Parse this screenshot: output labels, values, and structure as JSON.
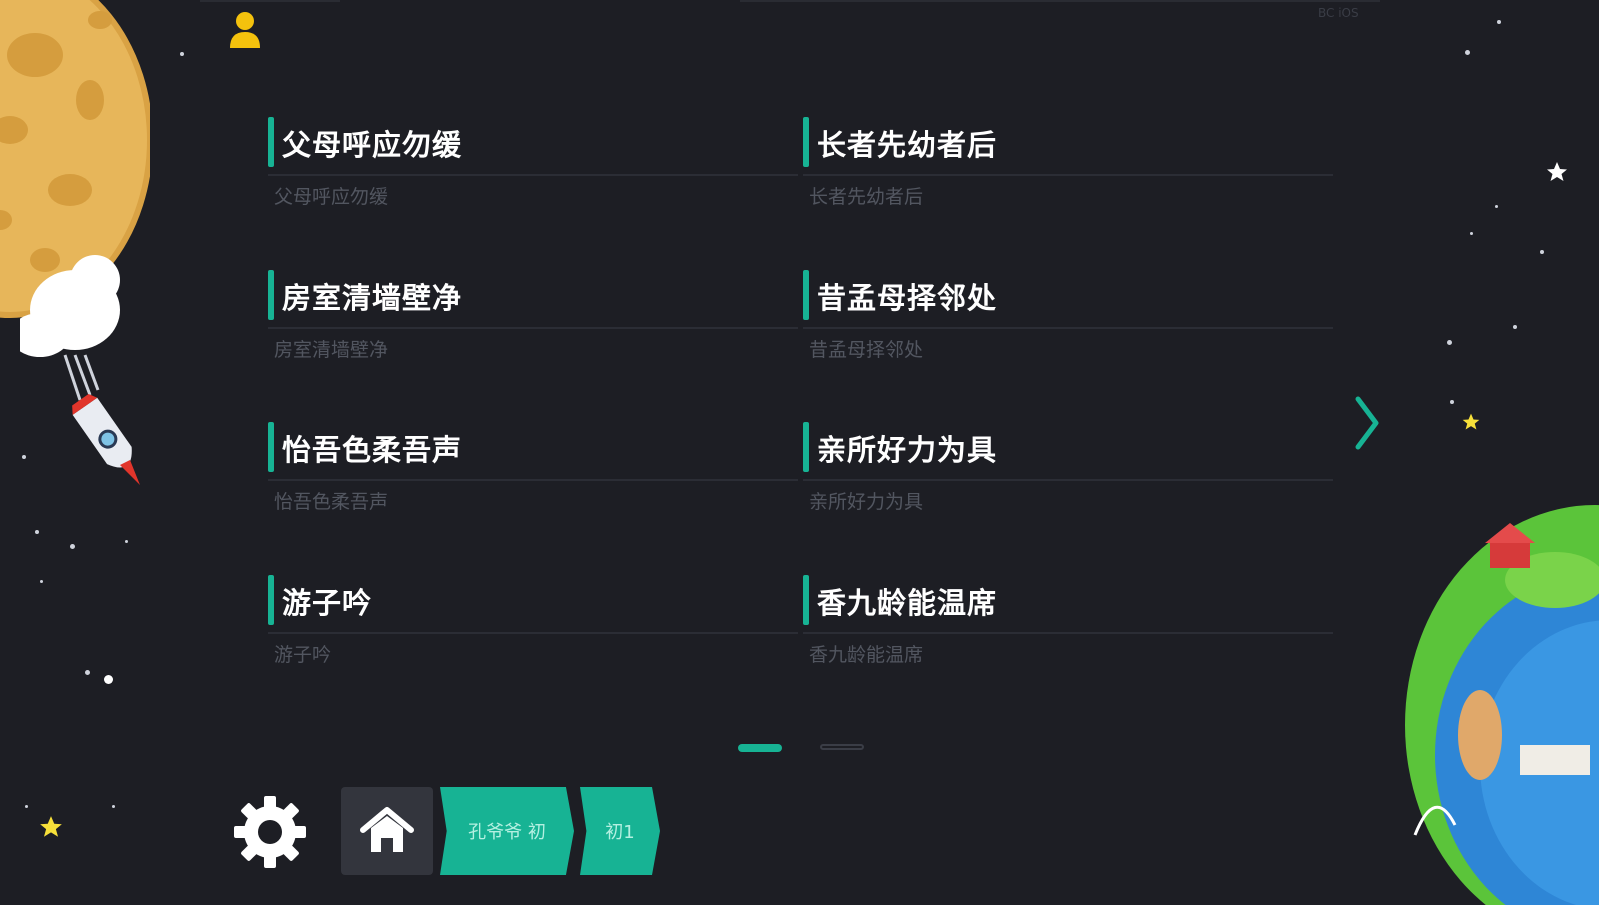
{
  "header": {
    "version_label": "BC iOS"
  },
  "items": [
    {
      "title": "父母呼应勿缓",
      "subtitle": "父母呼应勿缓"
    },
    {
      "title": "长者先幼者后",
      "subtitle": "长者先幼者后"
    },
    {
      "title": "房室清墙壁净",
      "subtitle": "房室清墙壁净"
    },
    {
      "title": "昔孟母择邻处",
      "subtitle": "昔孟母择邻处"
    },
    {
      "title": "怡吾色柔吾声",
      "subtitle": "怡吾色柔吾声"
    },
    {
      "title": "亲所好力为具",
      "subtitle": "亲所好力为具"
    },
    {
      "title": "游子吟",
      "subtitle": "游子吟"
    },
    {
      "title": "香九龄能温席",
      "subtitle": "香九龄能温席"
    }
  ],
  "pagination": {
    "current": 1,
    "total": 2
  },
  "breadcrumb": [
    {
      "label": "孔爷爷 初"
    },
    {
      "label": "初1"
    }
  ],
  "icons": {
    "user": "user-icon",
    "settings": "gear-icon",
    "home": "home-icon",
    "next": "chevron-right-icon"
  },
  "colors": {
    "background": "#1d1e24",
    "accent": "#17b394",
    "title_text": "#ffffff",
    "subtitle_text": "#525660",
    "user_icon": "#f4c20d"
  }
}
